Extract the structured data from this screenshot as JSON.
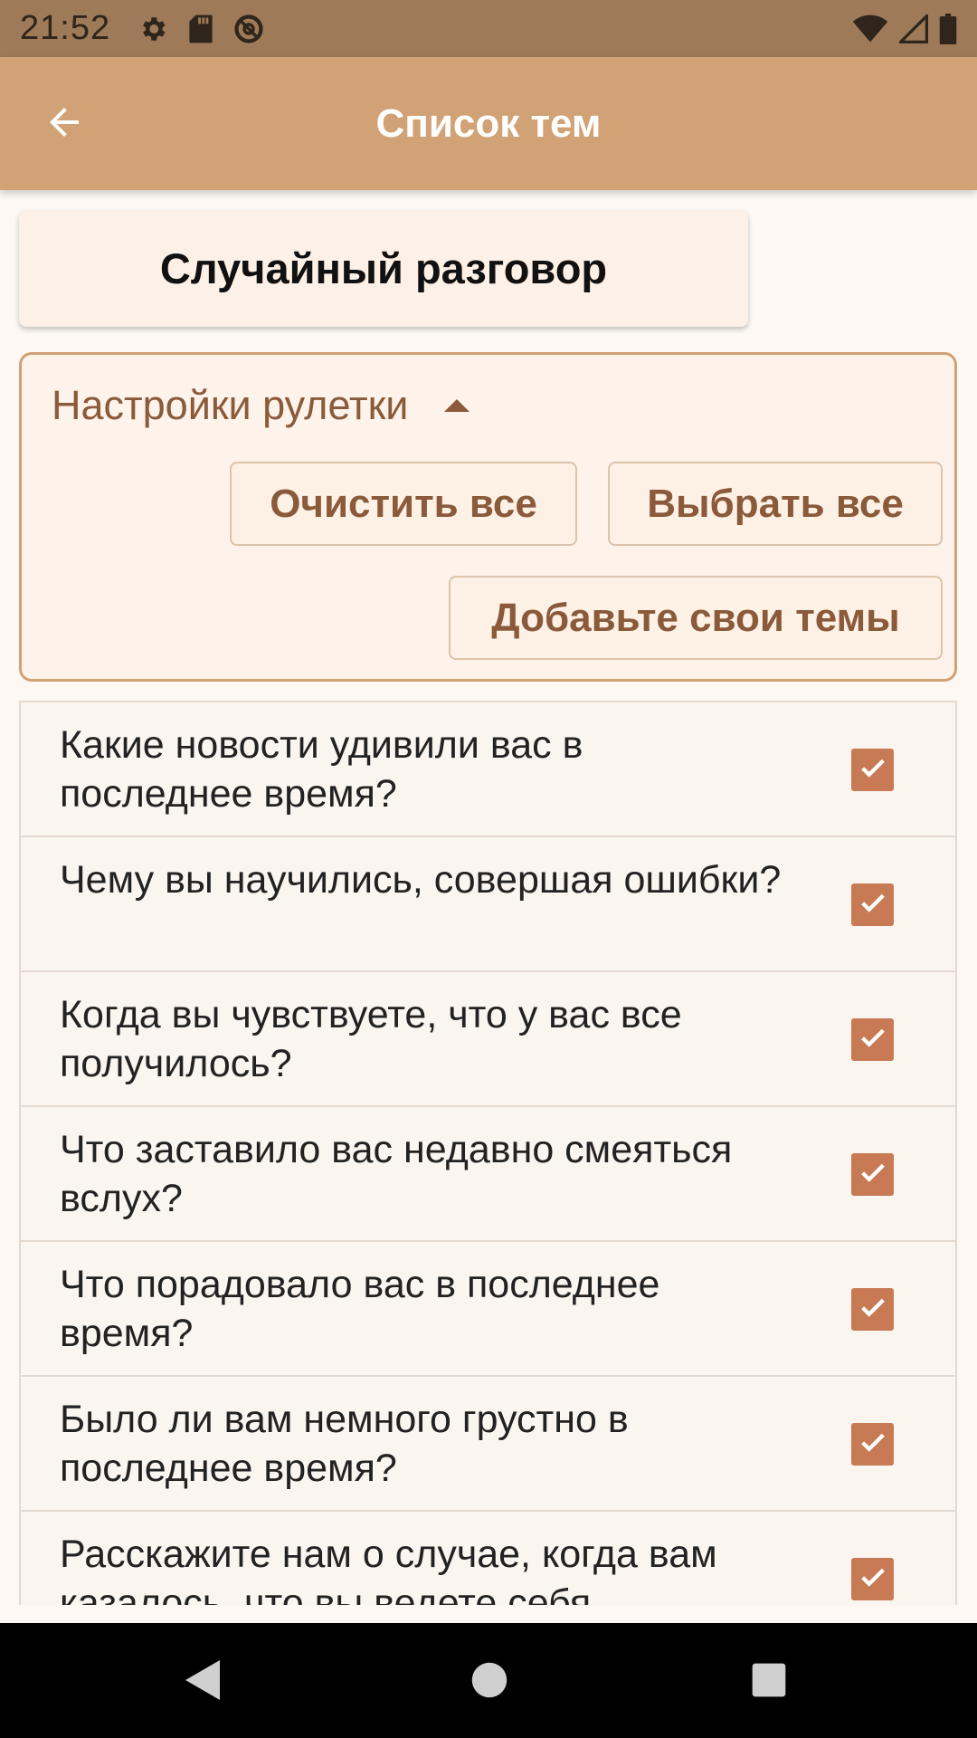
{
  "status_bar": {
    "time": "21:52",
    "left_icons": [
      "gear-icon",
      "sd-card-icon",
      "at-sign-icon"
    ],
    "right_icons": [
      "wifi-icon",
      "signal-icon",
      "battery-icon"
    ]
  },
  "app_bar": {
    "title": "Список тем",
    "back_icon": "arrow-left-icon"
  },
  "random_button": {
    "label": "Случайный разговор"
  },
  "settings": {
    "title": "Настройки рулетки",
    "expanded": true,
    "clear_all_label": "Очистить все",
    "select_all_label": "Выбрать все",
    "add_topics_label": "Добавьте свои темы"
  },
  "topics": [
    {
      "text": "Какие новости удивили вас в последнее время?",
      "checked": true
    },
    {
      "text": "Чему вы научились, совершая ошибки?",
      "checked": true
    },
    {
      "text": "Когда вы чувствуете, что у вас все получилось?",
      "checked": true
    },
    {
      "text": "Что заставило вас недавно смеяться вслух?",
      "checked": true
    },
    {
      "text": "Что порадовало вас в последнее время?",
      "checked": true
    },
    {
      "text": "Было ли вам немного грустно в последнее время?",
      "checked": true
    },
    {
      "text": "Расскажите нам о случае, когда вам казалось, что вы ведете себя",
      "checked": true
    }
  ],
  "colors": {
    "status_bar": "#9e7a58",
    "app_bar": "#d1a275",
    "accent_text": "#8a5a3a",
    "checkbox": "#c77a53",
    "background": "#fdf8f3"
  },
  "nav_bar": {
    "icons": [
      "nav-back-icon",
      "nav-home-icon",
      "nav-recent-icon"
    ]
  }
}
